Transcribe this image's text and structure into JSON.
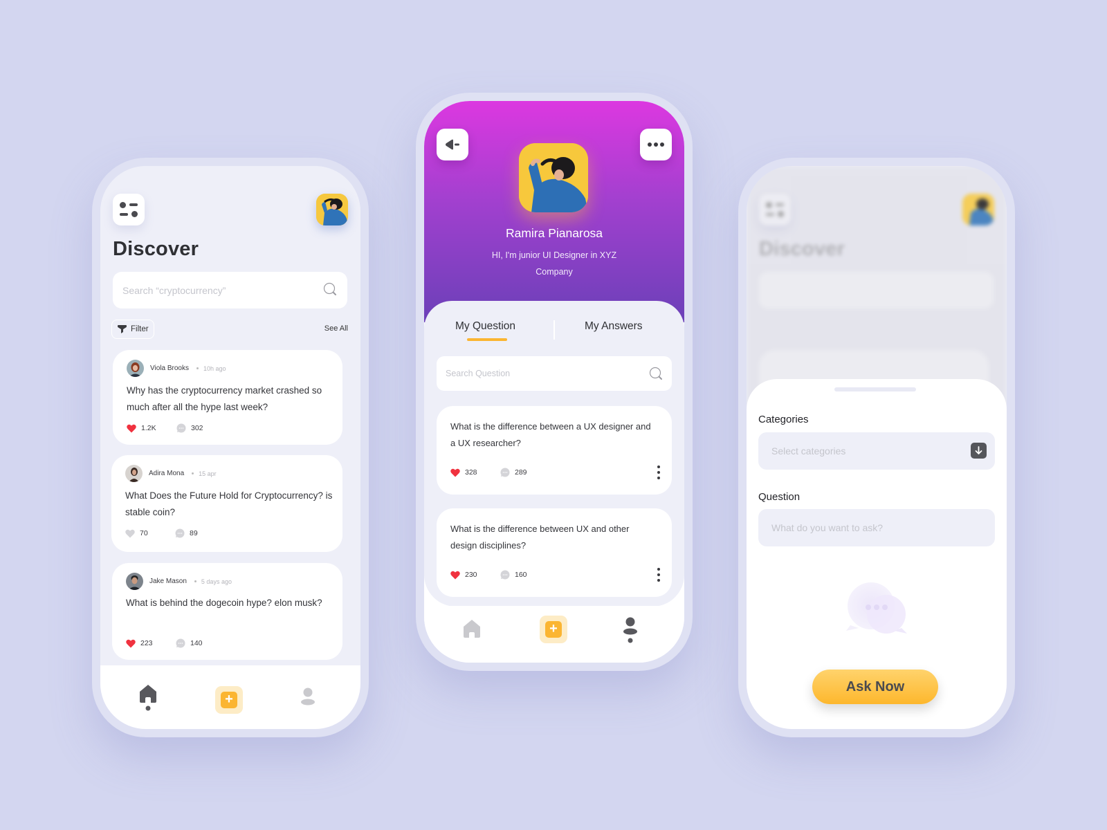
{
  "colors": {
    "background": "#d3d6f0",
    "accent": "#fbb532",
    "like_active": "#f0323f",
    "header_gradient_top": "#dc38e0",
    "header_gradient_bottom": "#6b40b8"
  },
  "discover": {
    "title": "Discover",
    "search_placeholder": "Search “cryptocurrency”",
    "filter_label": "Filter",
    "see_all_label": "See All",
    "posts": [
      {
        "author": "Viola Brooks",
        "time": "10h ago",
        "question": "Why has the cryptocurrency market crashed so much after all the hype last week?",
        "likes": "1.2K",
        "liked": true,
        "comments": "302"
      },
      {
        "author": "Adira Mona",
        "time": "15 apr",
        "question": "What Does the Future Hold for Cryptocurrency? is stable coin?",
        "likes": "70",
        "liked": false,
        "comments": "89"
      },
      {
        "author": "Jake Mason",
        "time": "5 days ago",
        "question": "What is behind the dogecoin hype? elon musk?",
        "likes": "223",
        "liked": true,
        "comments": "140"
      }
    ],
    "nav": {
      "active": "home",
      "add_label": "+"
    }
  },
  "profile": {
    "name": "Ramira Pianarosa",
    "bio": "HI, I'm junior UI Designer in XYZ Company",
    "tabs": [
      {
        "label": "My Question",
        "active": true
      },
      {
        "label": "My Answers",
        "active": false
      }
    ],
    "search_placeholder": "Search Question",
    "questions": [
      {
        "question": "What is the difference between a UX designer and a UX researcher?",
        "likes": "328",
        "comments": "289"
      },
      {
        "question": "What is the difference between UX and other design disciplines?",
        "likes": "230",
        "comments": "160"
      }
    ],
    "nav": {
      "active": "profile",
      "add_label": "+"
    }
  },
  "ask": {
    "background_title": "Discover",
    "categories_label": "Categories",
    "categories_placeholder": "Select categories",
    "question_label": "Question",
    "question_placeholder": "What do you want to ask?",
    "submit_label": "Ask Now"
  }
}
